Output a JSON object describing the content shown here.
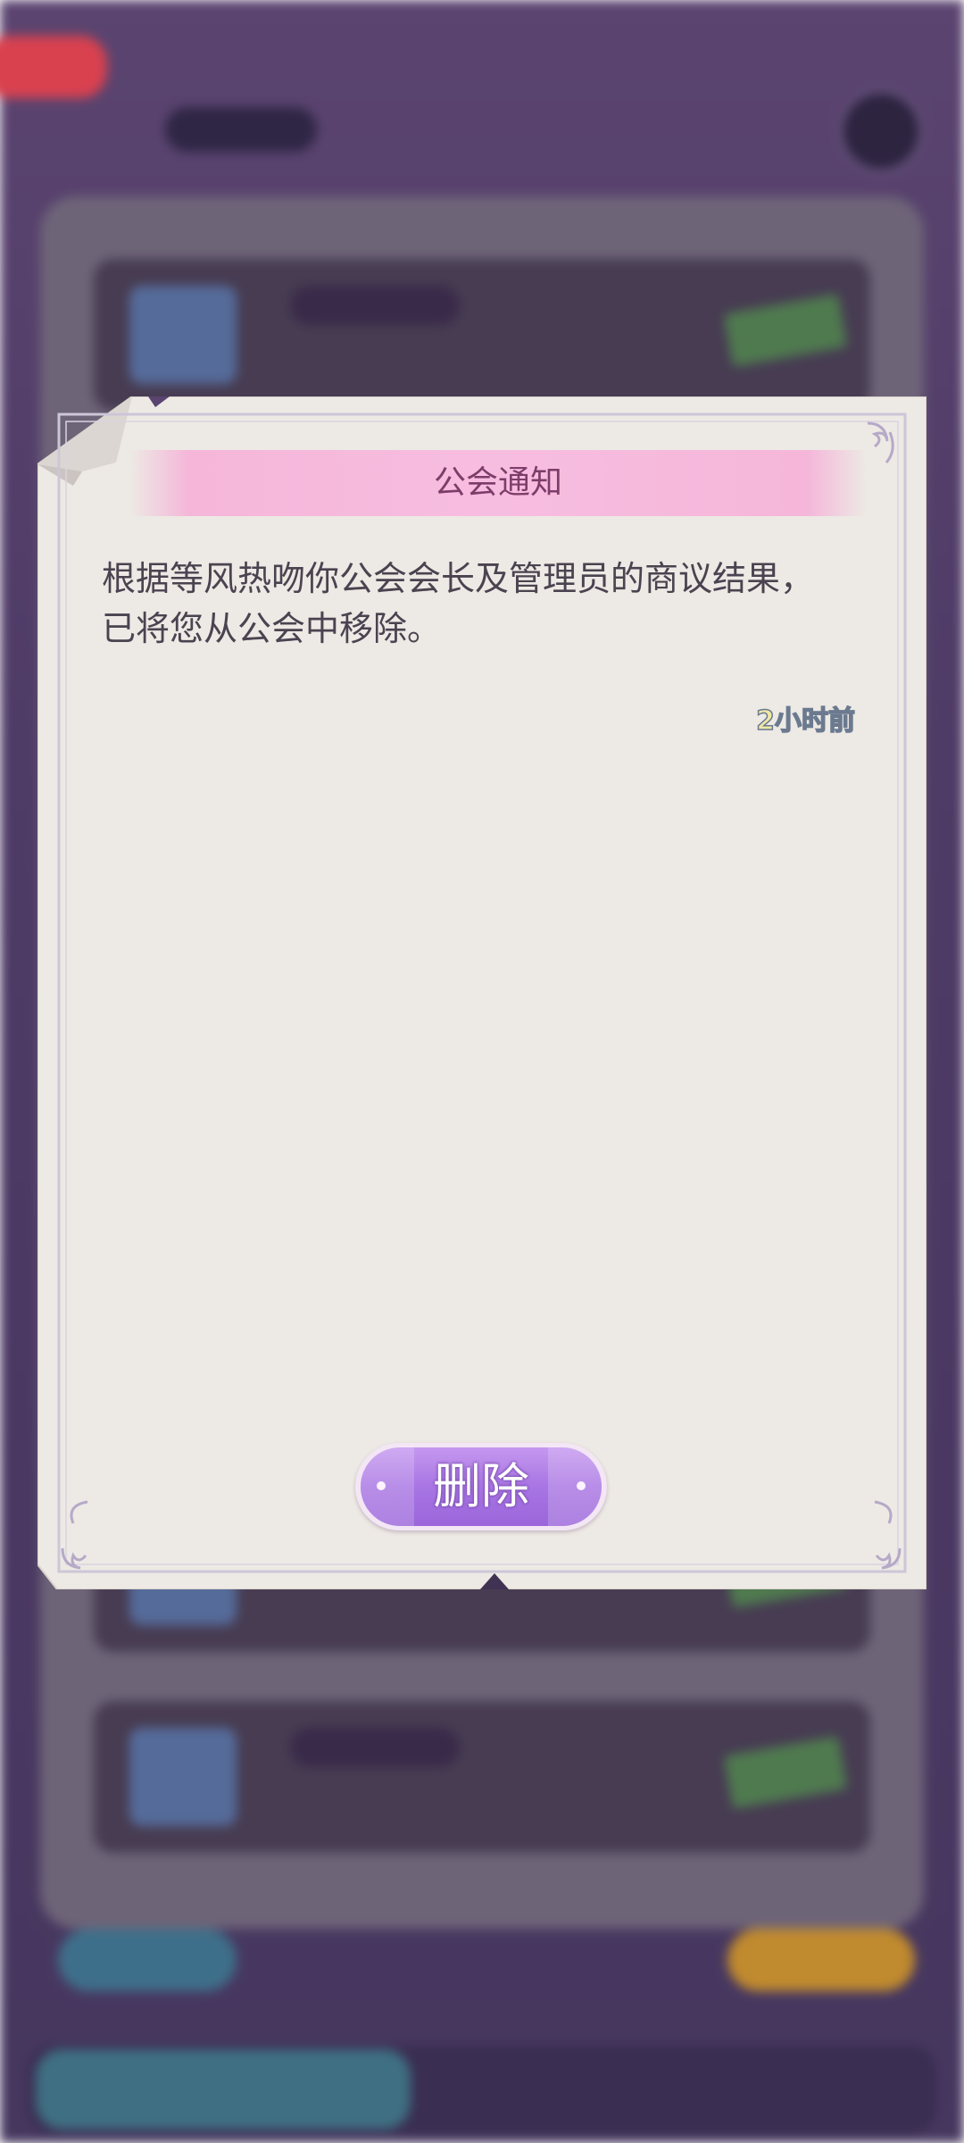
{
  "dialog": {
    "title": "公会通知",
    "message": "根据等风热吻你公会会长及管理员的商议结果，\n已将您从公会中移除。",
    "timestamp": "2小时前",
    "delete_label": "删除"
  },
  "colors": {
    "banner": "#f7bde0",
    "title_text": "#7d3d69",
    "paper": "#ede9e4",
    "button": "#a875e3"
  },
  "icons": {
    "corner": "corner-flourish-icon",
    "edit": "pencil-icon"
  }
}
